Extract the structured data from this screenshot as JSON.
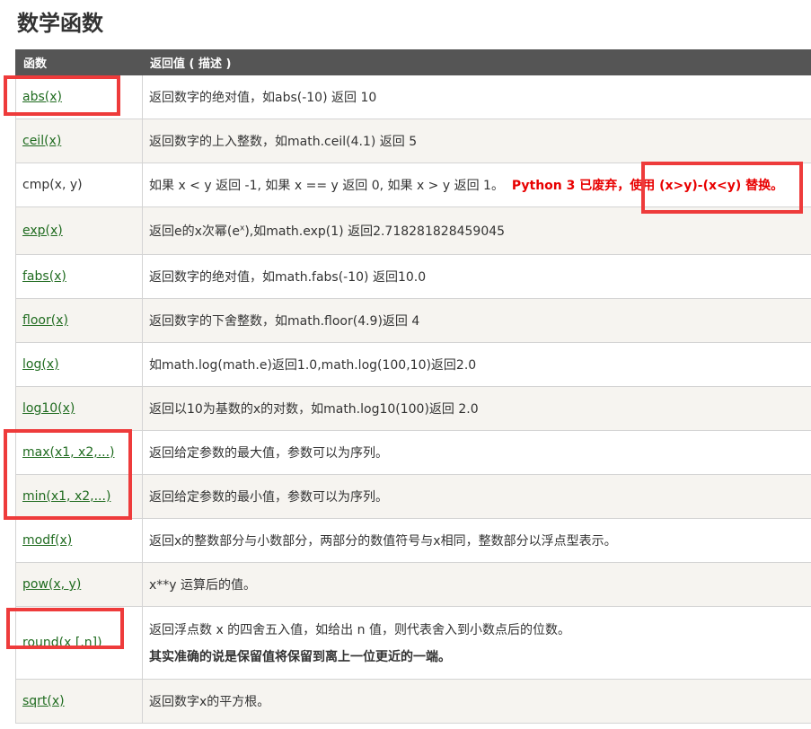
{
  "page_title": "数学函数",
  "table": {
    "headers": [
      "函数",
      "返回值 ( 描述 )"
    ],
    "rows": [
      {
        "func": "abs(x)",
        "link": true,
        "desc": "返回数字的绝对值，如abs(-10) 返回 10"
      },
      {
        "func": "ceil(x)",
        "link": true,
        "desc": "返回数字的上入整数，如math.ceil(4.1) 返回 5"
      },
      {
        "func": "cmp(x, y)",
        "link": false,
        "desc": "如果 x < y 返回 -1, 如果 x == y 返回 0, 如果 x > y 返回 1。",
        "warning": "Python 3 已废弃，使用 (x>y)-(x<y) 替换。"
      },
      {
        "func": "exp(x)",
        "link": true,
        "desc_pre": "返回e的x次幂(e",
        "desc_sup": "x",
        "desc_post": "),如math.exp(1) 返回2.718281828459045"
      },
      {
        "func": "fabs(x)",
        "link": true,
        "desc": "返回数字的绝对值，如math.fabs(-10) 返回10.0"
      },
      {
        "func": "floor(x)",
        "link": true,
        "desc": "返回数字的下舍整数，如math.floor(4.9)返回 4"
      },
      {
        "func": "log(x)",
        "link": true,
        "desc": "如math.log(math.e)返回1.0,math.log(100,10)返回2.0"
      },
      {
        "func": "log10(x)",
        "link": true,
        "desc": "返回以10为基数的x的对数，如math.log10(100)返回 2.0"
      },
      {
        "func": "max(x1, x2,...)",
        "link": true,
        "desc": "返回给定参数的最大值，参数可以为序列。"
      },
      {
        "func": "min(x1, x2,...)",
        "link": true,
        "desc": "返回给定参数的最小值，参数可以为序列。"
      },
      {
        "func": "modf(x)",
        "link": true,
        "desc": "返回x的整数部分与小数部分，两部分的数值符号与x相同，整数部分以浮点型表示。"
      },
      {
        "func": "pow(x, y)",
        "link": true,
        "desc": "x**y 运算后的值。"
      },
      {
        "func": "round(x [,n])",
        "link": true,
        "desc": "返回浮点数 x 的四舍五入值，如给出 n 值，则代表舍入到小数点后的位数。",
        "bold_note": "其实准确的说是保留值将保留到离上一位更近的一端。"
      },
      {
        "func": "sqrt(x)",
        "link": true,
        "desc": "返回数字x的平方根。"
      }
    ]
  }
}
